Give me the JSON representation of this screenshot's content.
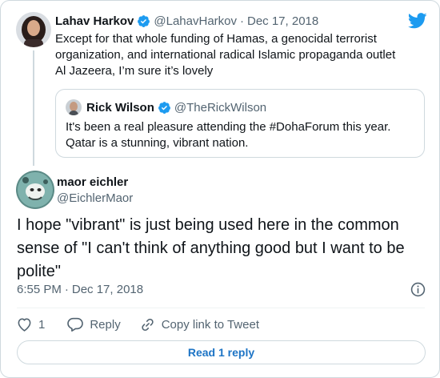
{
  "parent_tweet": {
    "author_name": "Lahav Harkov",
    "author_handle": "@LahavHarkov",
    "separator": "·",
    "date": "Dec 17, 2018",
    "text": "Except for that whole funding of Hamas, a genocidal terrorist organization, and international radical Islamic propaganda outlet Al Jazeera, I’m sure it’s lovely",
    "verified_icon": "verified-badge-icon"
  },
  "quoted_tweet": {
    "author_name": "Rick Wilson",
    "author_handle": "@TheRickWilson",
    "text": "It's been a real pleasure attending the #DohaForum this year. Qatar is a stunning, vibrant nation.",
    "verified_icon": "verified-badge-icon"
  },
  "main_tweet": {
    "author_name": "maor eichler",
    "author_handle": "@EichlerMaor",
    "text": "I hope \"vibrant\" is just being used here in the common sense of \"I can't think of anything good but I want to be polite\"",
    "time": "6:55 PM",
    "separator": "·",
    "date": "Dec 17, 2018"
  },
  "actions": {
    "like_count": "1",
    "reply_label": "Reply",
    "copy_link_label": "Copy link to Tweet"
  },
  "read_replies_label": "Read 1 reply",
  "colors": {
    "twitter_blue": "#1d9bf0",
    "link_blue": "#1d74c5",
    "secondary_text": "#536471",
    "border": "#cfd9de"
  }
}
